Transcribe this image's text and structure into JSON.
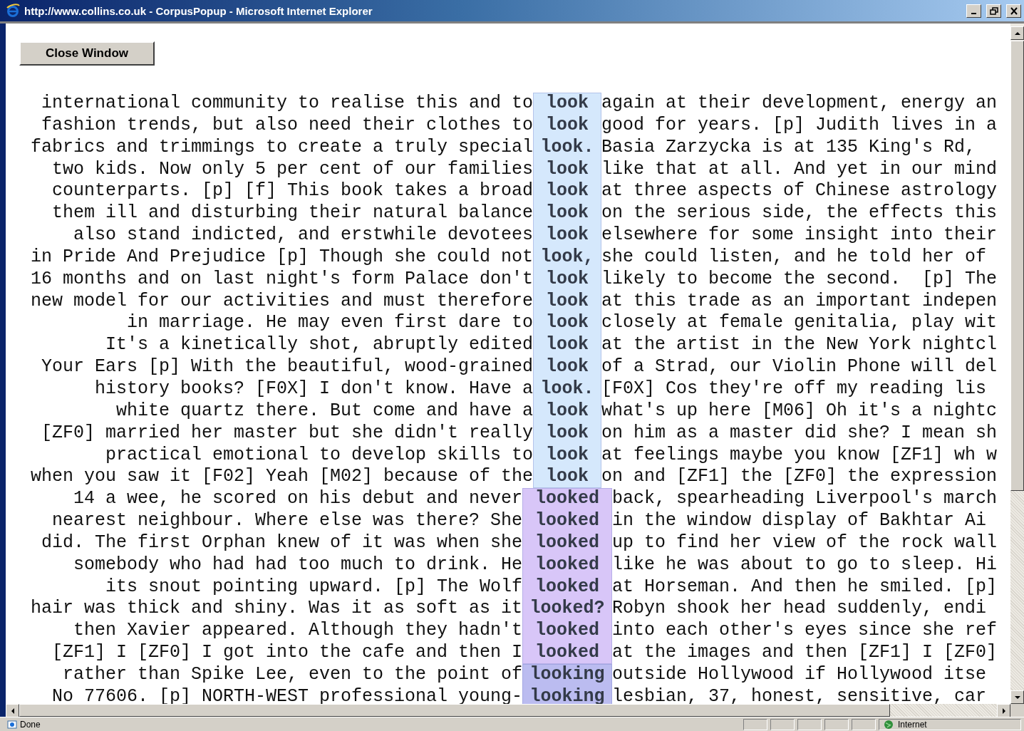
{
  "window": {
    "title": "http://www.collins.co.uk - CorpusPopup - Microsoft Internet Explorer"
  },
  "close_button": {
    "label": "Close Window"
  },
  "concordance": [
    {
      "color": "#d5e8fc",
      "lines": [
        {
          "left": "international community to realise this and to",
          "keyword": "look",
          "right": "again at their development, energy an"
        },
        {
          "left": "fashion trends, but also need their clothes to",
          "keyword": "look",
          "right": "good for years. [p] Judith lives in a"
        },
        {
          "left": "fabrics and trimmings to create a truly special",
          "keyword": "look.",
          "right": "Basia Zarzycka is at 135 King's Rd,"
        },
        {
          "left": "two kids. Now only 5 per cent of our families",
          "keyword": "look",
          "right": "like that at all. And yet in our mind"
        },
        {
          "left": "counterparts. [p] [f] This book takes a broad",
          "keyword": "look",
          "right": "at three aspects of Chinese astrology"
        },
        {
          "left": "them ill and disturbing their natural balance",
          "keyword": "look",
          "right": "on the serious side, the effects this"
        },
        {
          "left": "also stand indicted, and erstwhile devotees",
          "keyword": "look",
          "right": "elsewhere for some insight into their"
        },
        {
          "left": "in Pride And Prejudice [p] Though she could not",
          "keyword": "look,",
          "right": "she could listen, and he told her of"
        },
        {
          "left": "16 months and on last night's form Palace don't",
          "keyword": "look",
          "right": "likely to become the second.  [p] The"
        },
        {
          "left": "new model for our activities and must therefore",
          "keyword": "look",
          "right": "at this trade as an important indepen"
        },
        {
          "left": "in marriage. He may even first dare to",
          "keyword": "look",
          "right": "closely at female genitalia, play wit"
        },
        {
          "left": "It's a kinetically shot, abruptly edited",
          "keyword": "look",
          "right": "at the artist in the New York nightcl"
        },
        {
          "left": "Your Ears [p] With the beautiful, wood-grained",
          "keyword": "look",
          "right": "of a Strad, our Violin Phone will del"
        },
        {
          "left": "history books? [F0X] I don't know. Have a",
          "keyword": "look.",
          "right": "[F0X] Cos they're off my reading lis"
        },
        {
          "left": "white quartz there. But come and have a",
          "keyword": "look",
          "right": "what's up here [M06] Oh it's a nightc"
        },
        {
          "left": "[ZF0] married her master but she didn't really",
          "keyword": "look",
          "right": "on him as a master did she? I mean sh"
        },
        {
          "left": "practical emotional to develop skills to",
          "keyword": "look",
          "right": "at feelings maybe you know [ZF1] wh w"
        },
        {
          "left": "when you saw it [F02] Yeah [M02] because of the",
          "keyword": "look",
          "right": "on and [ZF1] the [ZF0] the expression"
        }
      ]
    },
    {
      "color": "#d8c6f8",
      "lines": [
        {
          "left": "14 a wee, he scored on his debut and never",
          "keyword": "looked",
          "right": "back, spearheading Liverpool's march"
        },
        {
          "left": "nearest neighbour. Where else was there? She",
          "keyword": "looked",
          "right": "in the window display of Bakhtar Ai"
        },
        {
          "left": "did. The first Orphan knew of it was when she",
          "keyword": "looked",
          "right": "up to find her view of the rock wall"
        },
        {
          "left": "somebody who had had too much to drink. He",
          "keyword": "looked",
          "right": "like he was about to go to sleep. Hi"
        },
        {
          "left": "its snout pointing upward. [p] The Wolf",
          "keyword": "looked",
          "right": "at Horseman. And then he smiled. [p]"
        },
        {
          "left": "hair was thick and shiny. Was it as soft as it",
          "keyword": "looked?",
          "right": "Robyn shook her head suddenly, endi"
        },
        {
          "left": "then Xavier appeared. Although they hadn't",
          "keyword": "looked",
          "right": "into each other's eyes since she ref"
        },
        {
          "left": "[ZF1] I [ZF0] I got into the cafe and then I",
          "keyword": "looked",
          "right": "at the images and then [ZF1] I [ZF0]"
        }
      ]
    },
    {
      "color": "#bbbcf0",
      "lines": [
        {
          "left": "rather than Spike Lee, even to the point of",
          "keyword": "looking",
          "right": "outside Hollywood if Hollywood itse"
        },
        {
          "left": "No 77606. [p] NORTH-WEST professional young-",
          "keyword": "looking",
          "right": "lesbian, 37, honest, sensitive, car"
        }
      ]
    }
  ],
  "status_bar": {
    "text": "Done",
    "zone": "Internet"
  }
}
